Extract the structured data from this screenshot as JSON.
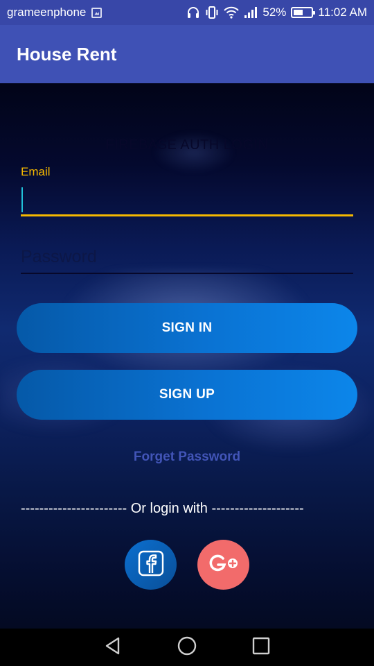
{
  "status_bar": {
    "carrier": "grameenphone",
    "battery_percent": "52%",
    "battery_level": 0.52,
    "time": "11:02 AM",
    "icons": [
      "image-icon",
      "headphones-icon",
      "vibrate-icon",
      "wifi-icon",
      "signal-icon",
      "battery-icon"
    ]
  },
  "app_bar": {
    "title": "House Rent"
  },
  "form": {
    "title": "FIREBASE AUTH LOGIN",
    "email_label": "Email",
    "email_value": "",
    "password_placeholder": "Password",
    "signin_label": "SIGN IN",
    "signup_label": "SIGN UP",
    "forget_password": "Forget Password",
    "or_login_with": "----------------------- Or login with --------------------"
  },
  "social": [
    {
      "name": "facebook",
      "icon": "facebook-icon",
      "color": "#0b62b8"
    },
    {
      "name": "google-plus",
      "icon": "google-plus-icon",
      "color": "#f26b6b"
    }
  ],
  "nav_bar": {
    "icons": [
      "back-icon",
      "home-icon",
      "recents-icon"
    ]
  },
  "colors": {
    "app_bar": "#3f51b5",
    "status_bar": "#3847a8",
    "accent": "#f5b800",
    "button": "#0a72d2",
    "link": "#4255b8"
  }
}
